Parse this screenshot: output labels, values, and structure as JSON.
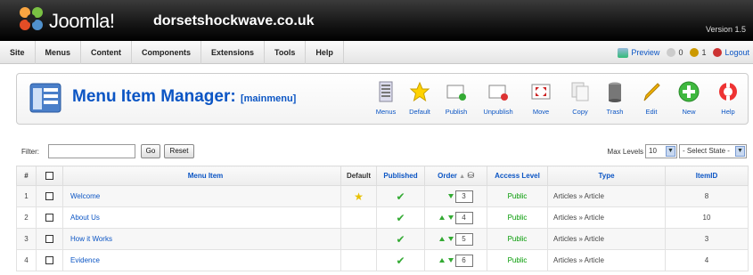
{
  "header": {
    "brand": "Joomla!",
    "site_name": "dorsetshockwave.co.uk",
    "version": "Version 1.5"
  },
  "menubar": {
    "items": [
      "Site",
      "Menus",
      "Content",
      "Components",
      "Extensions",
      "Tools",
      "Help"
    ],
    "preview": "Preview",
    "messages_count": "0",
    "users_online": "1",
    "logout": "Logout"
  },
  "toolbar": {
    "title": "Menu Item Manager:",
    "subtitle": "[mainmenu]",
    "buttons": [
      "Menus",
      "Default",
      "Publish",
      "Unpublish",
      "Move",
      "Copy",
      "Trash",
      "Edit",
      "New",
      "Help"
    ]
  },
  "filter": {
    "label": "Filter:",
    "value": "",
    "go": "Go",
    "reset": "Reset",
    "max_levels_label": "Max Levels",
    "max_levels_value": "10",
    "state_value": "- Select State -"
  },
  "table": {
    "headers": {
      "num": "#",
      "item": "Menu Item",
      "default": "Default",
      "published": "Published",
      "order": "Order",
      "access": "Access Level",
      "type": "Type",
      "id": "ItemID"
    },
    "rows": [
      {
        "num": "1",
        "item": "Welcome",
        "default": true,
        "order": "3",
        "access": "Public",
        "type": "Articles » Article",
        "id": "8"
      },
      {
        "num": "2",
        "item": "About Us",
        "default": false,
        "order": "4",
        "access": "Public",
        "type": "Articles » Article",
        "id": "10"
      },
      {
        "num": "3",
        "item": "How it Works",
        "default": false,
        "order": "5",
        "access": "Public",
        "type": "Articles » Article",
        "id": "3"
      },
      {
        "num": "4",
        "item": "Evidence",
        "default": false,
        "order": "6",
        "access": "Public",
        "type": "Articles » Article",
        "id": "4"
      }
    ]
  },
  "colors": {
    "link": "#0b55c4",
    "published_check": "#33aa33",
    "access_public": "#009900"
  }
}
